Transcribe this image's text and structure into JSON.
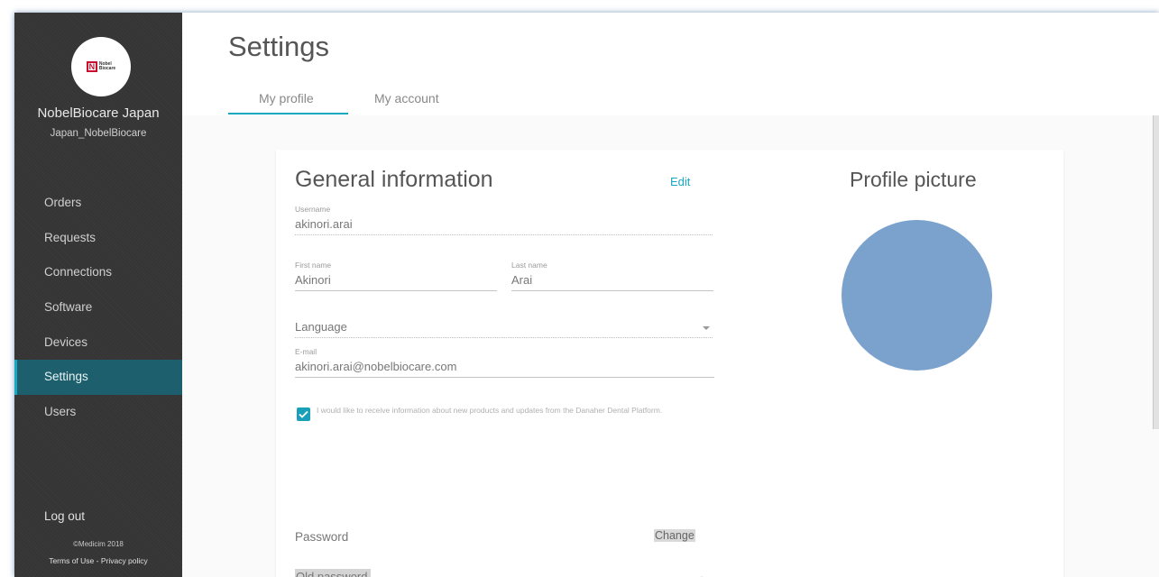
{
  "sidebar": {
    "logo_text_line1": "Nobel",
    "logo_text_line2": "Biocare",
    "org_name": "NobelBiocare Japan",
    "org_user": "Japan_NobelBiocare",
    "items": [
      {
        "label": "Orders"
      },
      {
        "label": "Requests"
      },
      {
        "label": "Connections"
      },
      {
        "label": "Software"
      },
      {
        "label": "Devices"
      },
      {
        "label": "Settings",
        "active": true
      },
      {
        "label": "Users"
      }
    ],
    "logout": "Log out",
    "copyright": "©Medicim 2018",
    "terms": "Terms of Use",
    "separator": " - ",
    "privacy": "Privacy policy"
  },
  "header": {
    "title": "Settings",
    "tabs": [
      {
        "label": "My profile",
        "active": true
      },
      {
        "label": "My account"
      }
    ]
  },
  "general": {
    "title": "General information",
    "edit": "Edit",
    "username_label": "Username",
    "username": "akinori.arai",
    "first_name_label": "First name",
    "first_name": "Akinori",
    "last_name_label": "Last name",
    "last_name": "Arai",
    "language_placeholder": "Language",
    "email_label": "E-mail",
    "email": "akinori.arai@nobelbiocare.com",
    "consent_checked": true,
    "consent_text": "I would like to receive information about new products and updates from the Danaher Dental Platform."
  },
  "password": {
    "label": "Password",
    "change": "Change",
    "old_placeholder": "Old password"
  },
  "profile_picture": {
    "title": "Profile picture",
    "avatar_color": "#7ba2cc"
  },
  "colors": {
    "accent": "#1aa7c2",
    "sidebar_bg": "#353535",
    "sidebar_active": "#1d5f6d"
  }
}
